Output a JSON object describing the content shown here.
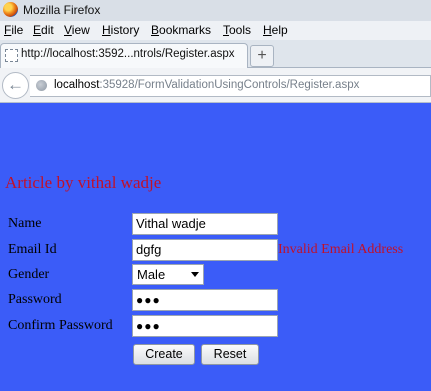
{
  "window": {
    "title": "Mozilla Firefox"
  },
  "menu": [
    "File",
    "Edit",
    "View",
    "History",
    "Bookmarks",
    "Tools",
    "Help"
  ],
  "tab": {
    "label": "http://localhost:3592...ntrols/Register.aspx",
    "new_tab": "+"
  },
  "address": {
    "host": "localhost",
    "rest": ":35928/FormValidationUsingControls/Register.aspx"
  },
  "page": {
    "heading": "Article by vithal wadje",
    "labels": {
      "name": "Name",
      "email": "Email Id",
      "gender": "Gender",
      "password": "Password",
      "confirm": "Confirm Password"
    },
    "values": {
      "name": "Vithal wadje",
      "email": "dgfg",
      "gender": "Male",
      "password": "●●●",
      "confirm": "●●●"
    },
    "email_error": "Invalid Email Address",
    "buttons": {
      "create": "Create",
      "reset": "Reset"
    }
  },
  "colors": {
    "page_background": "#3b5cf8",
    "error_text": "#c0112b",
    "heading_text": "#c0112b"
  }
}
